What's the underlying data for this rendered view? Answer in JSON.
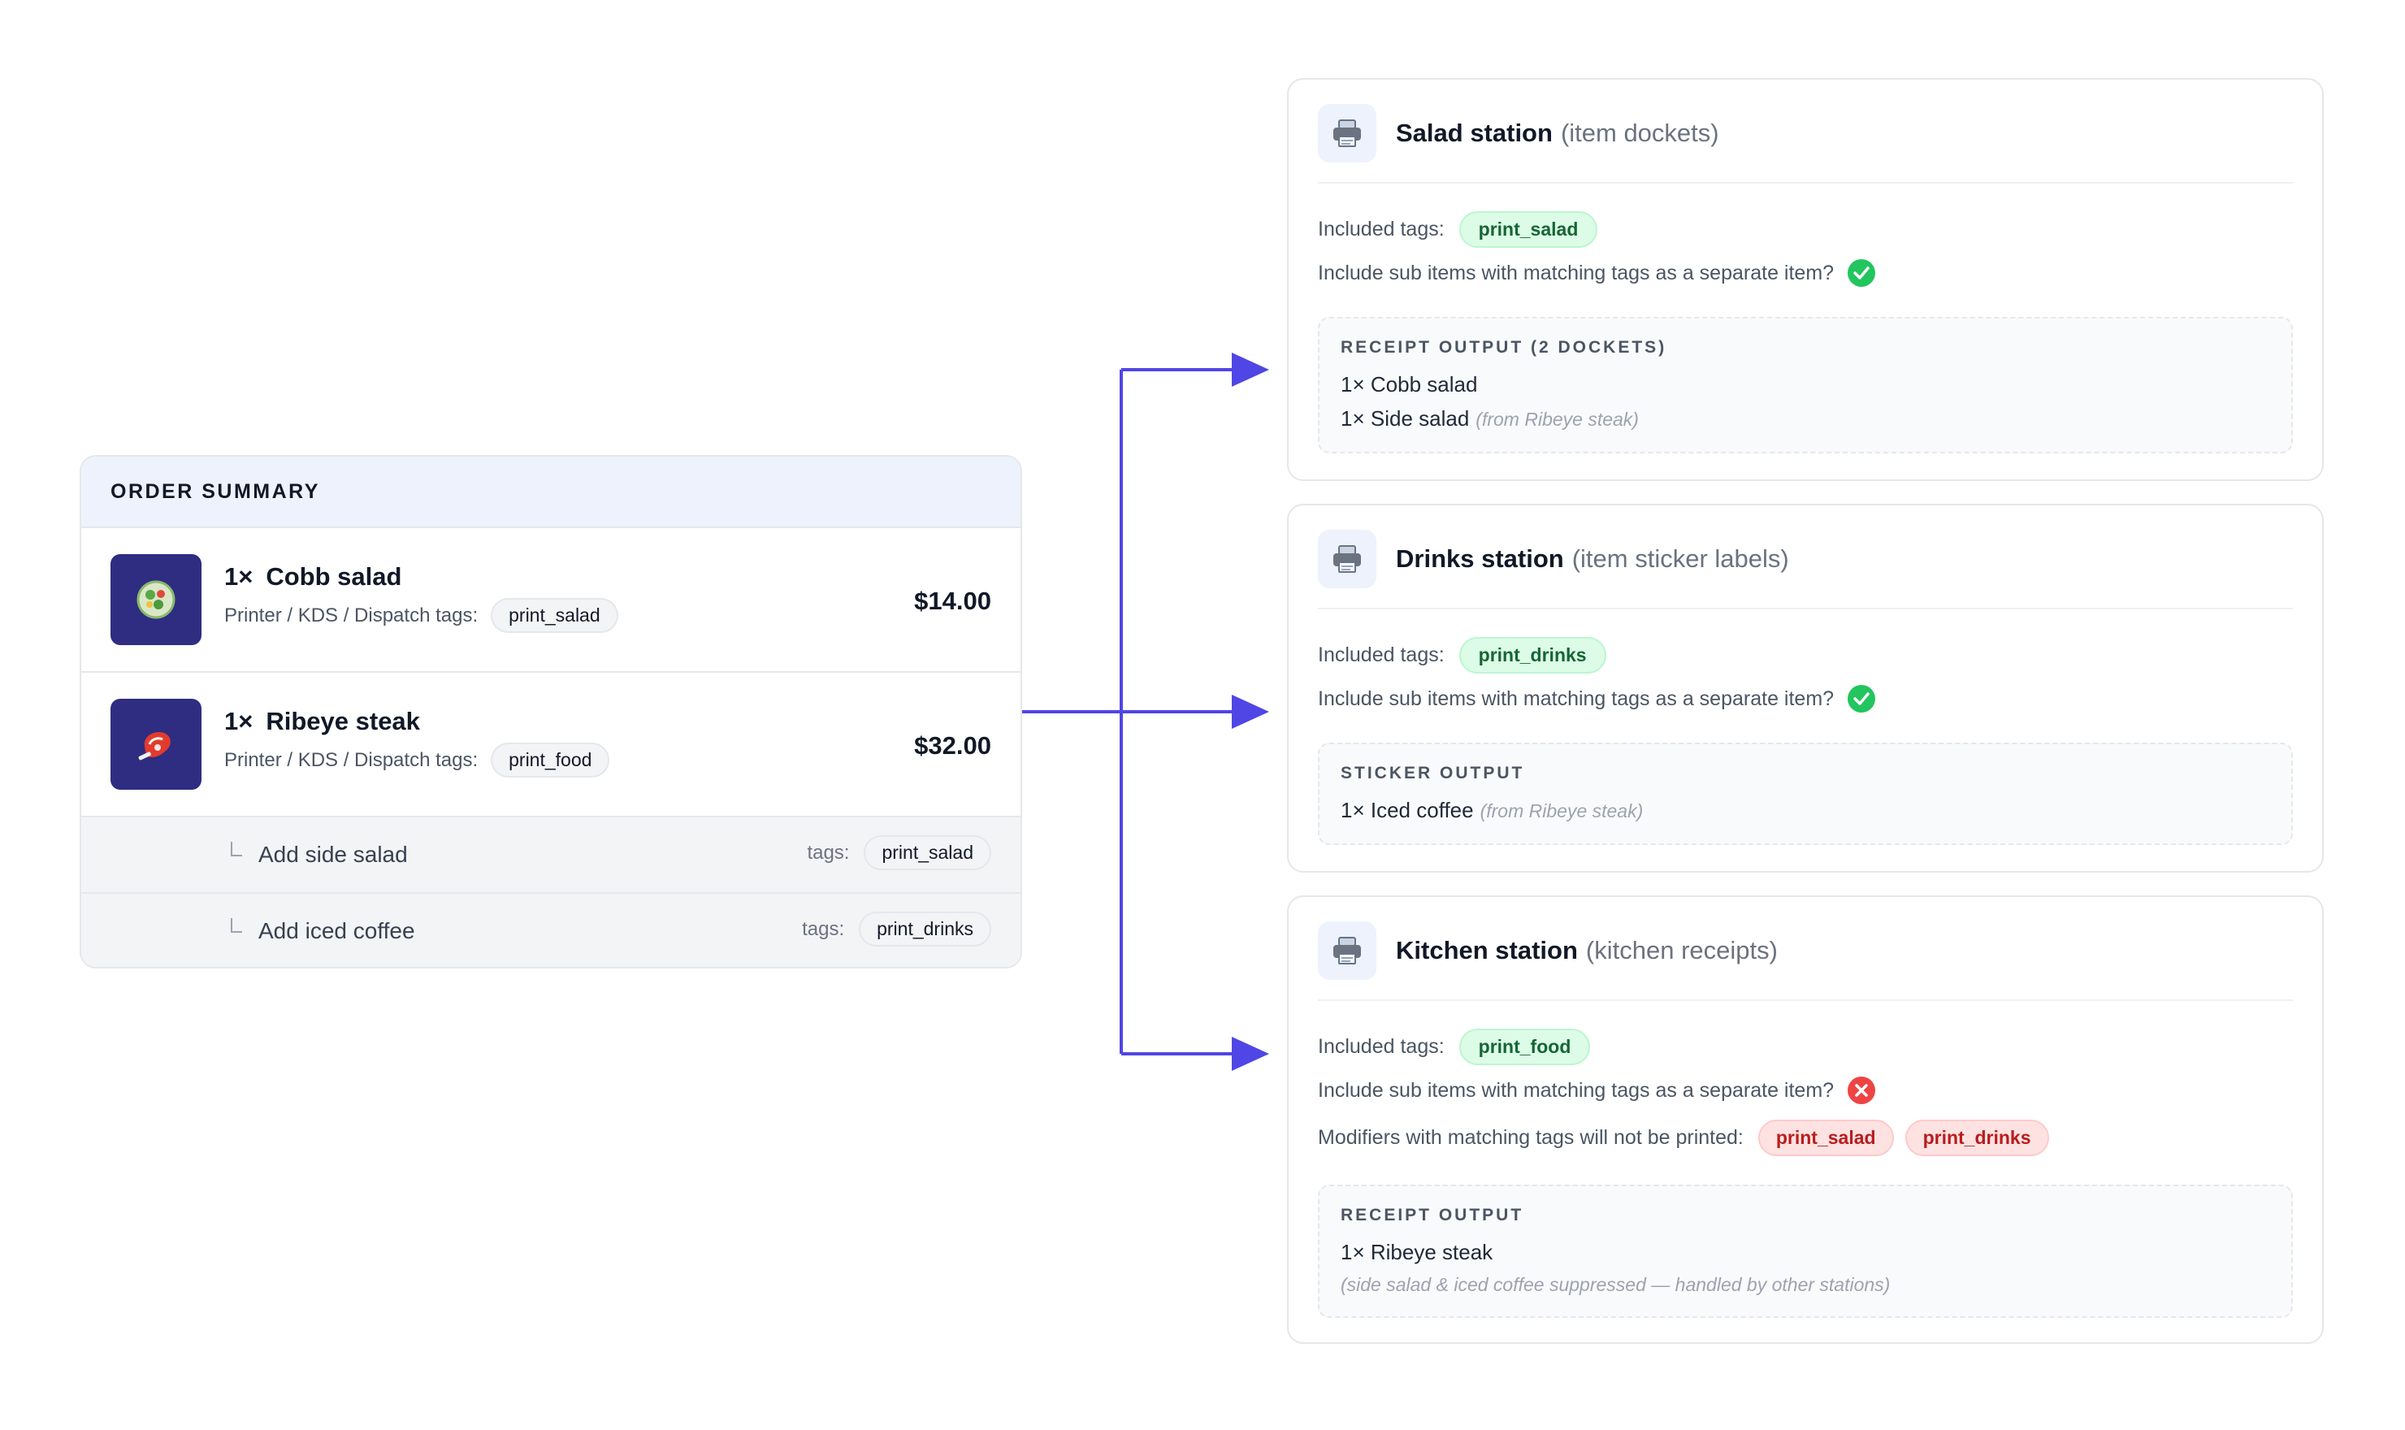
{
  "order": {
    "heading": "ORDER SUMMARY",
    "items": [
      {
        "qty": "1×",
        "name": "Cobb salad",
        "meta_label": "Printer / KDS / Dispatch tags:",
        "tag": "print_salad",
        "price": "$14.00",
        "icon": "salad-icon"
      },
      {
        "qty": "1×",
        "name": "Ribeye steak",
        "meta_label": "Printer / KDS / Dispatch tags:",
        "tag": "print_food",
        "price": "$32.00",
        "icon": "steak-icon"
      }
    ],
    "sub_items": [
      {
        "name": "Add side salad",
        "tags_label": "tags:",
        "tag": "print_salad"
      },
      {
        "name": "Add iced coffee",
        "tags_label": "tags:",
        "tag": "print_drinks"
      }
    ]
  },
  "stations": [
    {
      "title": "Salad station",
      "subtitle": "(item dockets)",
      "included_label": "Included tags:",
      "included_tag": "print_salad",
      "sub_items_question": "Include sub items with matching tags as a separate item?",
      "sub_items_enabled": true,
      "output_heading": "RECEIPT OUTPUT (2 DOCKETS)",
      "output_lines": [
        {
          "text": "1× Cobb salad",
          "note": ""
        },
        {
          "text": "1× Side salad",
          "note": "(from Ribeye steak)"
        }
      ]
    },
    {
      "title": "Drinks station",
      "subtitle": "(item sticker labels)",
      "included_label": "Included tags:",
      "included_tag": "print_drinks",
      "sub_items_question": "Include sub items with matching tags as a separate item?",
      "sub_items_enabled": true,
      "output_heading": "STICKER OUTPUT",
      "output_lines": [
        {
          "text": "1× Iced coffee",
          "note": "(from Ribeye steak)"
        }
      ]
    },
    {
      "title": "Kitchen station",
      "subtitle": "(kitchen receipts)",
      "included_label": "Included tags:",
      "included_tag": "print_food",
      "sub_items_question": "Include sub items with matching tags as a separate item?",
      "sub_items_enabled": false,
      "modifiers_label": "Modifiers with matching tags will not be printed:",
      "suppressed_tags": [
        "print_salad",
        "print_drinks"
      ],
      "output_heading": "RECEIPT OUTPUT",
      "output_lines": [
        {
          "text": "1× Ribeye steak",
          "note": ""
        }
      ],
      "output_note": "(side salad & iced coffee suppressed — handled by other stations)"
    }
  ],
  "colors": {
    "arrow": "#4f46e5",
    "success": "#22c55e",
    "error": "#ef4444",
    "thumb_bg": "#2e2d82"
  },
  "icons": [
    "printer-icon",
    "check-circle-icon",
    "x-circle-icon",
    "salad-icon",
    "steak-icon"
  ]
}
